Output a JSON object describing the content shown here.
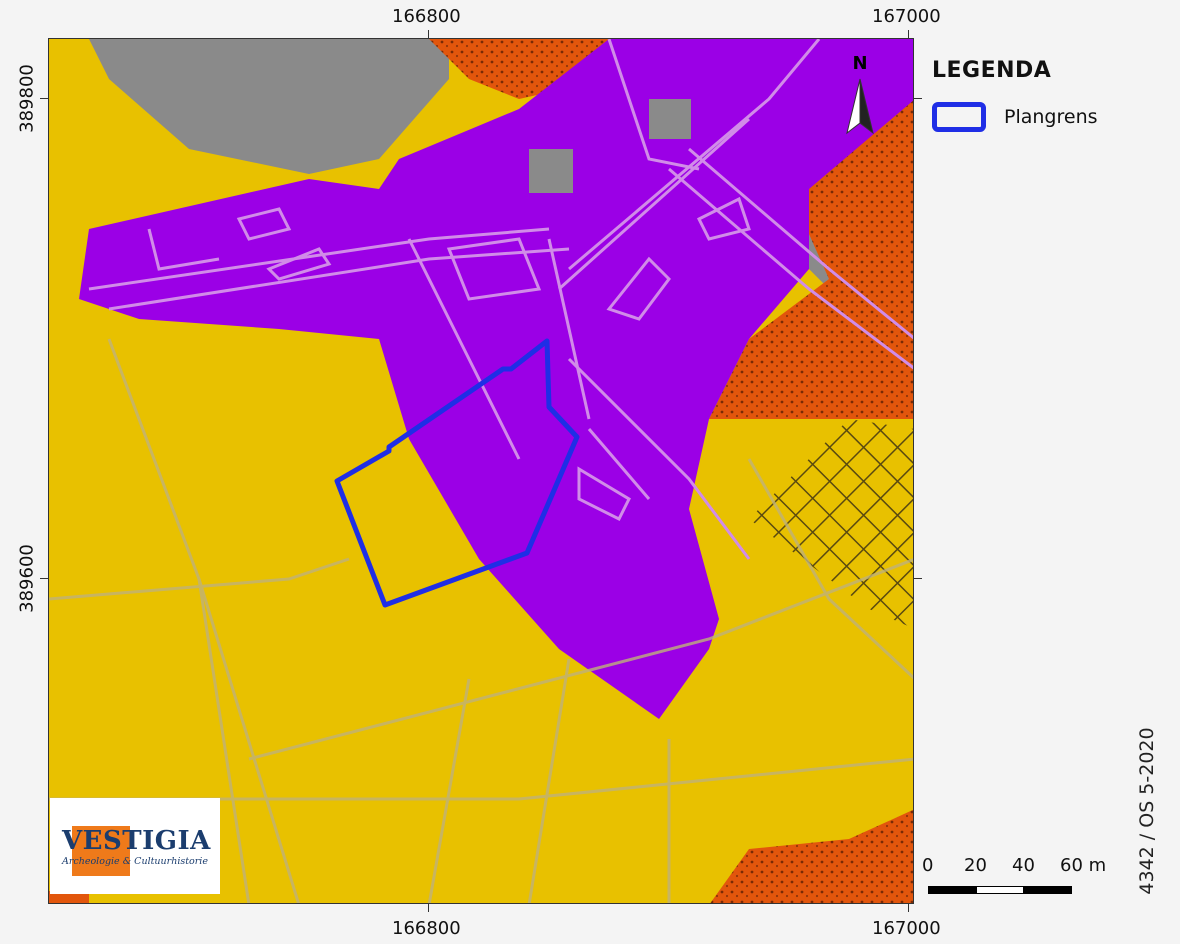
{
  "coordinates": {
    "x_labels": [
      "166800",
      "167000"
    ],
    "y_labels": [
      "389800",
      "389600"
    ]
  },
  "north_arrow": {
    "label": "N",
    "icon": "north-arrow-icon"
  },
  "legend": {
    "title": "LEGENDA",
    "items": [
      {
        "label": "Plangrens",
        "color": "#1f2ee6"
      }
    ]
  },
  "scale_bar": {
    "labels": [
      "0",
      "20",
      "40",
      "60 m"
    ]
  },
  "project_code": "4342 / OS 5-2020",
  "logo": {
    "name": "VESTIGIA",
    "subtitle": "Archeologie & Cultuurhistorie"
  },
  "colors": {
    "yellow_zone": "#e8c100",
    "purple_zone": "#9b00e6",
    "grey_zone": "#8a8a8a",
    "orange_zone": "#e2560c",
    "plan_boundary": "#1f2ee6"
  }
}
